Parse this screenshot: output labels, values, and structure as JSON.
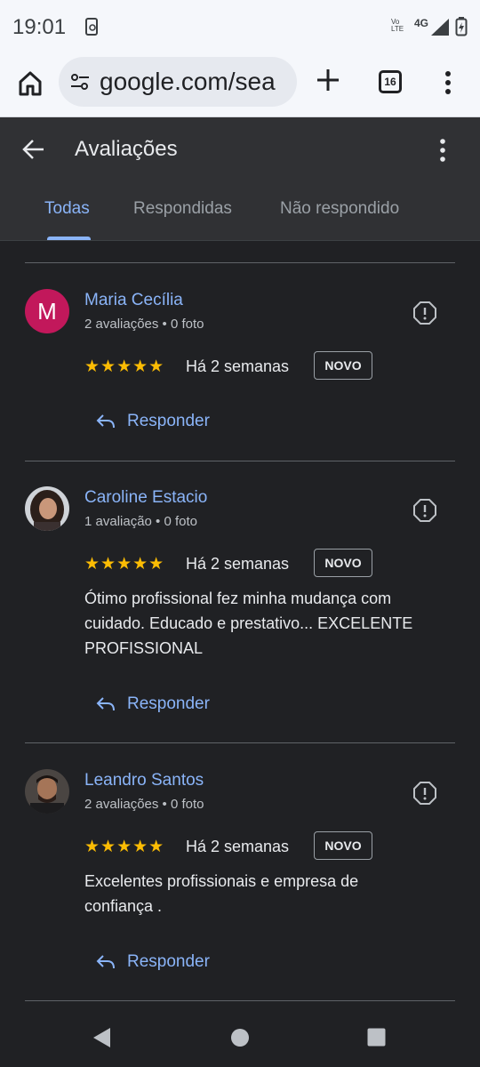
{
  "status": {
    "time": "19:01",
    "network": "4G",
    "volte": "Vo LTE"
  },
  "browser": {
    "url": "google.com/sea",
    "tab_count": "16"
  },
  "header": {
    "title": "Avaliações",
    "tabs": [
      {
        "label": "Todas",
        "active": true
      },
      {
        "label": "Respondidas",
        "active": false
      },
      {
        "label": "Não respondido",
        "active": false
      }
    ]
  },
  "reviews": [
    {
      "name": "Maria Cecília",
      "avatar_letter": "M",
      "meta": "2 avaliações • 0 foto",
      "stars": "★★★★★",
      "rating": 5,
      "time": "Há 2 semanas",
      "badge": "NOVO",
      "text_lines": [],
      "reply_label": "Responder"
    },
    {
      "name": "Caroline Estacio",
      "meta": "1 avaliação • 0 foto",
      "stars": "★★★★★",
      "rating": 5,
      "time": "Há 2 semanas",
      "badge": "NOVO",
      "text_lines": [
        "Ótimo profissional fez minha mudança com",
        "cuidado. Educado e prestativo... EXCELENTE",
        "PROFISSIONAL"
      ],
      "reply_label": "Responder"
    },
    {
      "name": "Leandro Santos",
      "meta": "2 avaliações • 0 foto",
      "stars": "★★★★★",
      "rating": 5,
      "time": "Há 2 semanas",
      "badge": "NOVO",
      "text_lines": [
        "Excelentes profissionais e empresa de",
        "confiança ."
      ],
      "reply_label": "Responder"
    }
  ],
  "colors": {
    "accent": "#8ab4f8",
    "star": "#fbbc04",
    "background": "#202124",
    "header_bg": "#303134",
    "avatar_m": "#c2185b"
  }
}
